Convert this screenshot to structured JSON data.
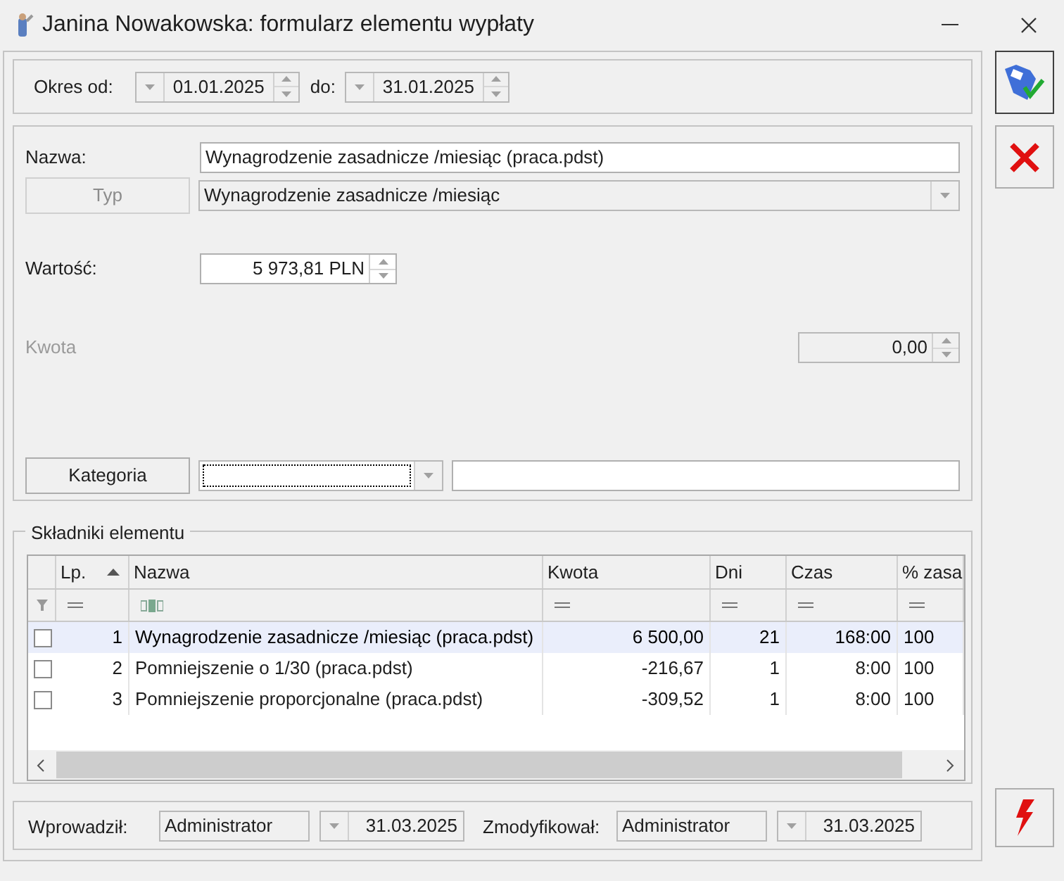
{
  "window": {
    "title": "Janina Nowakowska: formularz elementu wypłaty"
  },
  "period": {
    "from_label": "Okres od:",
    "from": "01.01.2025",
    "to_label": "do:",
    "to": "31.01.2025"
  },
  "form": {
    "name_label": "Nazwa:",
    "name": "Wynagrodzenie zasadnicze /miesiąc (praca.pdst)",
    "type_button": "Typ",
    "type_disabled": true,
    "type": "Wynagrodzenie zasadnicze /miesiąc",
    "value_label": "Wartość:",
    "value": "5 973,81 PLN",
    "amount_label": "Kwota",
    "amount_disabled": true,
    "amount": "0,00",
    "category_button": "Kategoria"
  },
  "components": {
    "title": "Składniki elementu",
    "columns": [
      {
        "label": "Lp.",
        "sorted": true,
        "kind": "number"
      },
      {
        "label": "Nazwa",
        "sorted": false,
        "kind": "text"
      },
      {
        "label": "Kwota",
        "sorted": false,
        "kind": "number"
      },
      {
        "label": "Dni",
        "sorted": false,
        "kind": "number"
      },
      {
        "label": "Czas",
        "sorted": false,
        "kind": "number"
      },
      {
        "label": "% zasa",
        "sorted": false,
        "kind": "number"
      }
    ],
    "rows": [
      {
        "selected": true,
        "checked": false,
        "cells": [
          "1",
          "Wynagrodzenie zasadnicze /miesiąc (praca.pdst)",
          "6 500,00",
          "21",
          "168:00",
          "100"
        ]
      },
      {
        "selected": false,
        "checked": false,
        "cells": [
          "2",
          "Pomniejszenie o 1/30 (praca.pdst)",
          "-216,67",
          "1",
          "8:00",
          "100"
        ]
      },
      {
        "selected": false,
        "checked": false,
        "cells": [
          "3",
          "Pomniejszenie proporcjonalne (praca.pdst)",
          "-309,52",
          "1",
          "8:00",
          "100"
        ]
      }
    ]
  },
  "footer": {
    "created_label": "Wprowadził:",
    "created_by": "Administrator",
    "created_date": "31.03.2025",
    "modified_label": "Zmodyfikował:",
    "modified_by": "Administrator",
    "modified_date": "31.03.2025"
  }
}
